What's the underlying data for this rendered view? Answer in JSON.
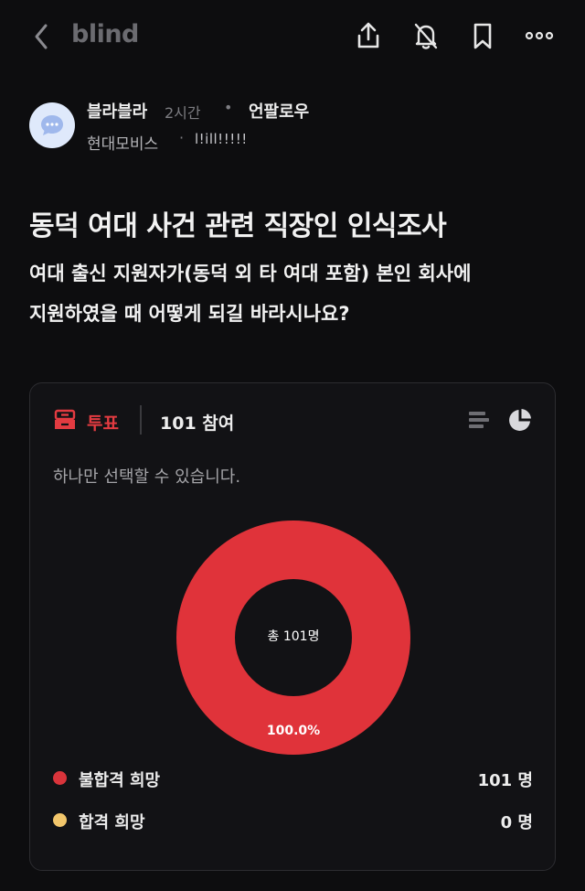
{
  "header": {
    "brand": "blind",
    "back_icon": "chevron-left-icon",
    "share_icon": "share-icon",
    "notify_icon": "bell-off-icon",
    "bookmark_icon": "bookmark-icon",
    "more_icon": "more-horizontal-icon"
  },
  "post": {
    "author": "블라블라",
    "time": "2시간",
    "separator": "•",
    "unfollow_label": "언팔로우",
    "company": "현대모비스",
    "company_separator": "·",
    "nickname": "l!ill!!!!!",
    "title": "동덕 여대 사건 관련 직장인 인식조사",
    "body_lines": [
      "여대 출신 지원자가(동덕 외 타 여대 포함) 본인 회사에",
      "지원하였을 때 어떻게 되길 바라시나요?"
    ]
  },
  "poll": {
    "label": "투표",
    "participants": "101 참여",
    "instruction": "하나만 선택할 수 있습니다.",
    "colors": {
      "accent": "#e33b41",
      "option1": "#d9343b",
      "option2": "#f2c66b"
    }
  },
  "chart_data": {
    "type": "pie",
    "center_label": "총 101명",
    "slices": [
      {
        "label": "불합격 희망",
        "value": 101,
        "count_text": "101 명",
        "percent": 100.0,
        "percent_text": "100.0%",
        "color": "#e0333a"
      },
      {
        "label": "합격 희망",
        "value": 0,
        "count_text": "0 명",
        "percent": 0.0,
        "color": "#f2c66b"
      }
    ]
  }
}
